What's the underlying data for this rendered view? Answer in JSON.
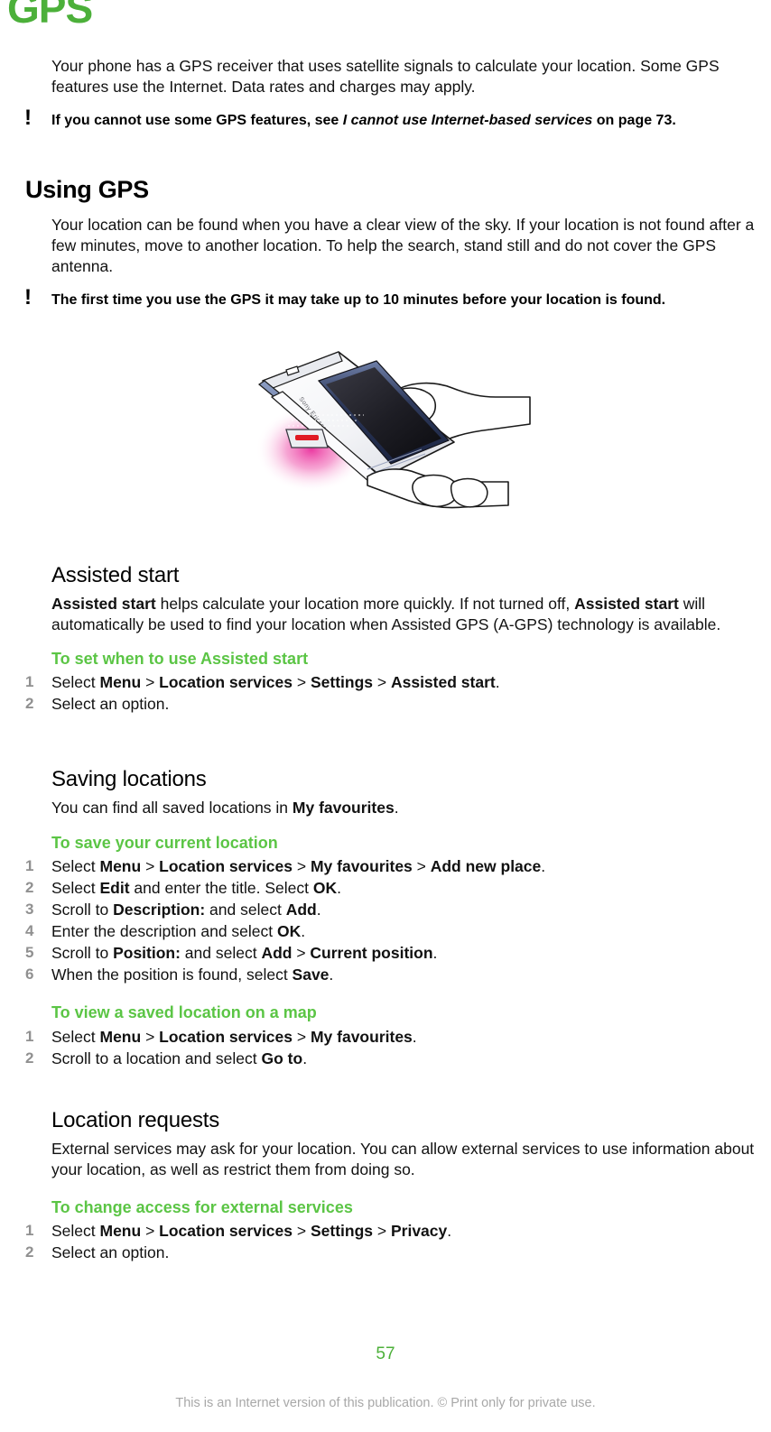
{
  "chapter": {
    "title": "GPS"
  },
  "intro": {
    "paragraph": "Your phone has a GPS receiver that uses satellite signals to calculate your location. Some GPS features use the Internet. Data rates and charges may apply.",
    "note": {
      "icon": "exclamation-icon",
      "prefix": "If you cannot use some GPS features, see ",
      "emphasis": "I cannot use Internet-based services",
      "suffix": " on page 73."
    }
  },
  "using_gps": {
    "heading": "Using GPS",
    "paragraph": "Your location can be found when you have a clear view of the sky. If your location is not found after a few minutes, move to another location. To help the search, stand still and do not cover the GPS antenna.",
    "note": {
      "icon": "exclamation-icon",
      "text": "The first time you use the GPS it may take up to 10 minutes before your location is found."
    },
    "figure": {
      "alt": "Hand holding a Sony Ericsson phone with GPS antenna area glowing pink",
      "brand_label": "Sony Ericsson",
      "glow_color": "#e8359e",
      "antenna_color": "#e01b24"
    }
  },
  "assisted_start": {
    "heading": "Assisted start",
    "paragraph_parts": [
      {
        "text": "Assisted start",
        "bold": true
      },
      {
        "text": " helps calculate your location more quickly. If not turned off, ",
        "bold": false
      },
      {
        "text": "Assisted start",
        "bold": true
      },
      {
        "text": " will automatically be used to find your location when Assisted GPS (A-GPS) technology is available.",
        "bold": false
      }
    ],
    "procedure": {
      "title": "To set when to use Assisted start",
      "steps": [
        [
          {
            "text": "Select ",
            "bold": false
          },
          {
            "text": "Menu",
            "bold": true
          },
          {
            "text": " > ",
            "bold": false,
            "sep": true
          },
          {
            "text": "Location services",
            "bold": true
          },
          {
            "text": " > ",
            "bold": false,
            "sep": true
          },
          {
            "text": "Settings",
            "bold": true
          },
          {
            "text": " > ",
            "bold": false,
            "sep": true
          },
          {
            "text": "Assisted start",
            "bold": true
          },
          {
            "text": ".",
            "bold": false
          }
        ],
        [
          {
            "text": "Select an option.",
            "bold": false
          }
        ]
      ]
    }
  },
  "saving_locations": {
    "heading": "Saving locations",
    "paragraph_parts": [
      {
        "text": "You can find all saved locations in ",
        "bold": false
      },
      {
        "text": "My favourites",
        "bold": true
      },
      {
        "text": ".",
        "bold": false
      }
    ],
    "procedure_save": {
      "title": "To save your current location",
      "steps": [
        [
          {
            "text": "Select ",
            "bold": false
          },
          {
            "text": "Menu",
            "bold": true
          },
          {
            "text": " > ",
            "bold": false,
            "sep": true
          },
          {
            "text": "Location services",
            "bold": true
          },
          {
            "text": " > ",
            "bold": false,
            "sep": true
          },
          {
            "text": "My favourites",
            "bold": true
          },
          {
            "text": " > ",
            "bold": false,
            "sep": true
          },
          {
            "text": "Add new place",
            "bold": true
          },
          {
            "text": ".",
            "bold": false
          }
        ],
        [
          {
            "text": "Select ",
            "bold": false
          },
          {
            "text": "Edit",
            "bold": true
          },
          {
            "text": " and enter the title. Select ",
            "bold": false
          },
          {
            "text": "OK",
            "bold": true
          },
          {
            "text": ".",
            "bold": false
          }
        ],
        [
          {
            "text": "Scroll to ",
            "bold": false
          },
          {
            "text": "Description:",
            "bold": true
          },
          {
            "text": " and select ",
            "bold": false
          },
          {
            "text": "Add",
            "bold": true
          },
          {
            "text": ".",
            "bold": false
          }
        ],
        [
          {
            "text": "Enter the description and select ",
            "bold": false
          },
          {
            "text": "OK",
            "bold": true
          },
          {
            "text": ".",
            "bold": false
          }
        ],
        [
          {
            "text": "Scroll to ",
            "bold": false
          },
          {
            "text": "Position:",
            "bold": true
          },
          {
            "text": " and select ",
            "bold": false
          },
          {
            "text": "Add",
            "bold": true
          },
          {
            "text": " > ",
            "bold": false,
            "sep": true
          },
          {
            "text": "Current position",
            "bold": true
          },
          {
            "text": ".",
            "bold": false
          }
        ],
        [
          {
            "text": "When the position is found, select ",
            "bold": false
          },
          {
            "text": "Save",
            "bold": true
          },
          {
            "text": ".",
            "bold": false
          }
        ]
      ]
    },
    "procedure_view": {
      "title": "To view a saved location on a map",
      "steps": [
        [
          {
            "text": "Select ",
            "bold": false
          },
          {
            "text": "Menu",
            "bold": true
          },
          {
            "text": " > ",
            "bold": false,
            "sep": true
          },
          {
            "text": "Location services",
            "bold": true
          },
          {
            "text": " > ",
            "bold": false,
            "sep": true
          },
          {
            "text": "My favourites",
            "bold": true
          },
          {
            "text": ".",
            "bold": false
          }
        ],
        [
          {
            "text": "Scroll to a location and select ",
            "bold": false
          },
          {
            "text": "Go to",
            "bold": true
          },
          {
            "text": ".",
            "bold": false
          }
        ]
      ]
    }
  },
  "location_requests": {
    "heading": "Location requests",
    "paragraph": "External services may ask for your location. You can allow external services to use information about your location, as well as restrict them from doing so.",
    "procedure": {
      "title": "To change access for external services",
      "steps": [
        [
          {
            "text": "Select ",
            "bold": false
          },
          {
            "text": "Menu",
            "bold": true
          },
          {
            "text": " > ",
            "bold": false,
            "sep": true
          },
          {
            "text": "Location services",
            "bold": true
          },
          {
            "text": " > ",
            "bold": false,
            "sep": true
          },
          {
            "text": "Settings",
            "bold": true
          },
          {
            "text": " > ",
            "bold": false,
            "sep": true
          },
          {
            "text": "Privacy",
            "bold": true
          },
          {
            "text": ".",
            "bold": false
          }
        ],
        [
          {
            "text": "Select an option.",
            "bold": false
          }
        ]
      ]
    }
  },
  "footer": {
    "page_number": "57",
    "notice": "This is an Internet version of this publication. © Print only for private use."
  },
  "colors": {
    "brand_green": "#4cb03a",
    "heading_green": "#5bc545",
    "step_number_gray": "#909090",
    "footer_gray": "#a8a8a8"
  }
}
